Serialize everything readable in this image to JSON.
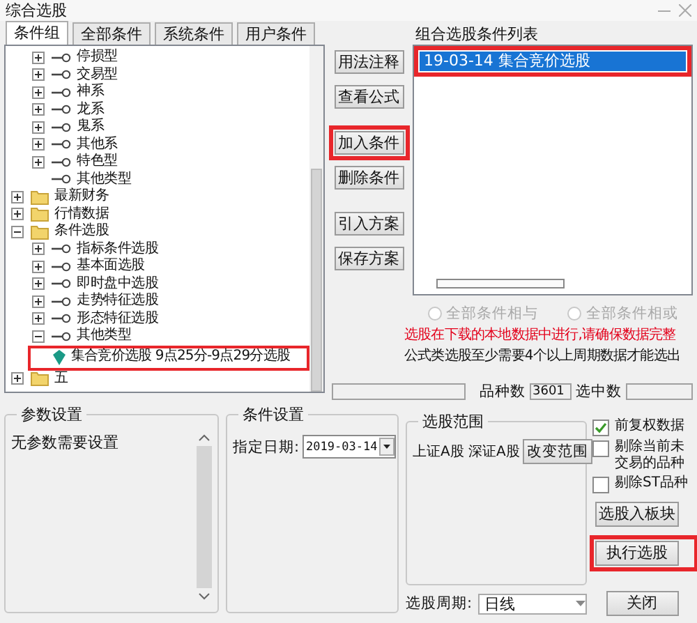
{
  "window": {
    "title": "综合选股"
  },
  "tabs": [
    {
      "label": "条件组",
      "selected": true
    },
    {
      "label": "全部条件",
      "selected": false
    },
    {
      "label": "系统条件",
      "selected": false
    },
    {
      "label": "用户条件",
      "selected": false
    }
  ],
  "tree": {
    "continued_children": [
      {
        "label": "停损型",
        "kind": "key",
        "expanded": false
      },
      {
        "label": "交易型",
        "kind": "key",
        "expanded": false
      },
      {
        "label": "神系",
        "kind": "key",
        "expanded": false
      },
      {
        "label": "龙系",
        "kind": "key",
        "expanded": false
      },
      {
        "label": "鬼系",
        "kind": "key",
        "expanded": false
      },
      {
        "label": "其他系",
        "kind": "key",
        "expanded": false
      },
      {
        "label": "特色型",
        "kind": "key",
        "expanded": false
      },
      {
        "label": "其他类型",
        "kind": "key"
      }
    ],
    "items": [
      {
        "label": "最新财务",
        "kind": "folder",
        "expanded": false
      },
      {
        "label": "行情数据",
        "kind": "folder",
        "expanded": false
      },
      {
        "label": "条件选股",
        "kind": "folder",
        "expanded": true,
        "children": [
          {
            "label": "指标条件选股",
            "kind": "key",
            "expanded": false
          },
          {
            "label": "基本面选股",
            "kind": "key",
            "expanded": false
          },
          {
            "label": "即时盘中选股",
            "kind": "key",
            "expanded": false
          },
          {
            "label": "走势特征选股",
            "kind": "key",
            "expanded": false
          },
          {
            "label": "形态特征选股",
            "kind": "key",
            "expanded": false
          },
          {
            "label": "其他类型",
            "kind": "key",
            "expanded": true,
            "children": [
              {
                "label": "集合竞价选股 9点25分-9点29分选股",
                "kind": "formula",
                "highlighted": true
              }
            ]
          }
        ]
      },
      {
        "label": "五",
        "kind": "folder",
        "expanded": false
      }
    ]
  },
  "tool_buttons": [
    {
      "label": "用法注释",
      "highlighted": false
    },
    {
      "label": "查看公式",
      "highlighted": false
    },
    {
      "label": "加入条件",
      "highlighted": true
    },
    {
      "label": "删除条件",
      "highlighted": false
    },
    {
      "label": "引入方案",
      "highlighted": false
    },
    {
      "label": "保存方案",
      "highlighted": false
    }
  ],
  "condition_list": {
    "title": "组合选股条件列表",
    "items": [
      {
        "label": "19-03-14 集合竞价选股",
        "selected": true,
        "highlighted": true
      }
    ]
  },
  "combine_options": [
    {
      "label": "全部条件相与",
      "selected": false,
      "disabled": true
    },
    {
      "label": "全部条件相或",
      "selected": false,
      "disabled": true
    }
  ],
  "notices": [
    {
      "text": "选股在下载的本地数据中进行,请确保数据完整",
      "kind": "warning"
    },
    {
      "text": "公式类选股至少需要4个以上周期数据才能选出",
      "kind": "info"
    }
  ],
  "status_bar": {
    "count_label": "品种数",
    "count": "3601",
    "selected_label": "选中数"
  },
  "param_group": {
    "title": "参数设置",
    "message": "无参数需要设置"
  },
  "condition_group": {
    "title": "条件设置",
    "date_label": "指定日期:",
    "date": "2019-03-14"
  },
  "range_group": {
    "title": "选股范围",
    "markets": "上证A股 深证A股",
    "button": "改变范围"
  },
  "options": [
    {
      "label": "前复权数据",
      "checked": true
    },
    {
      "label": "剔除当前未交易的品种",
      "checked": false
    },
    {
      "label": "剔除ST品种",
      "checked": false
    }
  ],
  "action_buttons": [
    {
      "label": "选股入板块",
      "highlighted": false
    },
    {
      "label": "执行选股",
      "highlighted": true
    }
  ],
  "period": {
    "label": "选股周期:",
    "value": "日线"
  },
  "close_button": {
    "label": "关闭"
  }
}
